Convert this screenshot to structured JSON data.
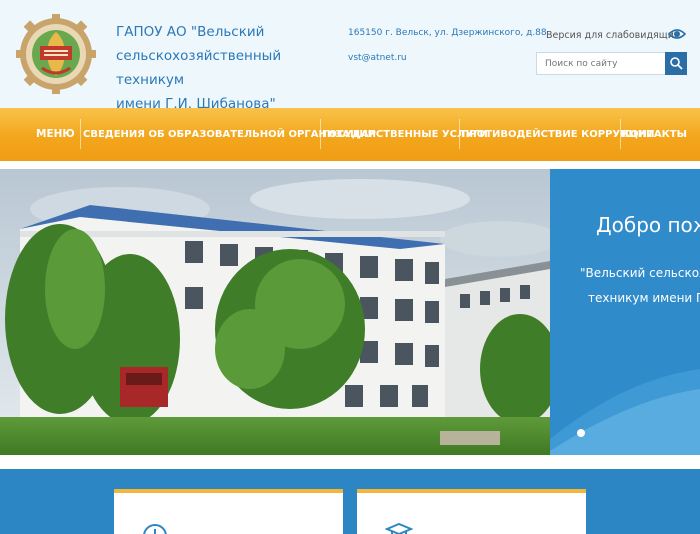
{
  "header": {
    "org_line1": "ГАПОУ АО \"Вельский",
    "org_line2": "сельскохозяйственный техникум",
    "org_line3": "имени Г.И. Шибанова\"",
    "address": "165150 г. Вельск, ул. Дзержинского, д.88",
    "email": "vst@atnet.ru",
    "vision_label": "Версия для слабовидящих",
    "search_placeholder": "Поиск по сайту"
  },
  "nav": {
    "items": [
      {
        "label": "МЕНЮ"
      },
      {
        "label": "СВЕДЕНИЯ ОБ ОБРАЗОВАТЕЛЬНОЙ ОРГАНИЗАЦИИ"
      },
      {
        "label": "ГОСУДАРСТВЕННЫЕ УСЛУГИ"
      },
      {
        "label": "ПРОТИВОДЕЙСТВИЕ КОРРУПЦИИ"
      },
      {
        "label": "КОНТАКТЫ"
      }
    ]
  },
  "banner": {
    "welcome_title": "Добро пожаловать",
    "welcome_sub1": "\"Вельский сельскохозяйственный",
    "welcome_sub2": "техникум имени Г.И. Шибанова\""
  },
  "colors": {
    "accent_blue": "#2b78b8",
    "nav_orange": "#f3a61c",
    "panel_blue": "#2f8bc9"
  }
}
